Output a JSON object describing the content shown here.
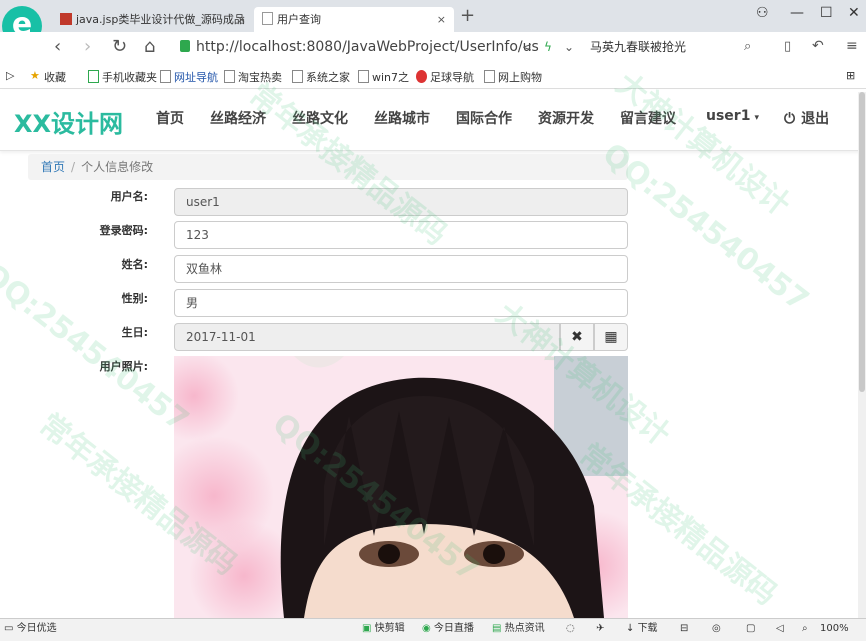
{
  "browser": {
    "tabs": [
      {
        "label": "java.jsp类毕业设计代做_源码成品"
      },
      {
        "label": "用户查询"
      }
    ],
    "url": "http://localhost:8080/JavaWebProject/UserInfo/us",
    "search_text": "马英九春联被抢光",
    "bookmarks": [
      "收藏",
      "手机收藏夹",
      "网址导航",
      "淘宝热卖",
      "系统之家",
      "win7之",
      "足球导航",
      "网上购物"
    ]
  },
  "site": {
    "brand": "XX设计网",
    "menu": [
      "首页",
      "丝路经济",
      "丝路文化",
      "丝路城市",
      "国际合作",
      "资源开发",
      "留言建议"
    ],
    "user": "user1",
    "logout": "退出"
  },
  "breadcrumb": {
    "home": "首页",
    "current": "个人信息修改"
  },
  "form": {
    "username_label": "用户名:",
    "username": "user1",
    "password_label": "登录密码:",
    "password": "123",
    "name_label": "姓名:",
    "name": "双鱼林",
    "gender_label": "性别:",
    "gender": "男",
    "birthday_label": "生日:",
    "birthday": "2017-11-01",
    "photo_label": "用户照片:"
  },
  "statusbar": {
    "left": "今日优选",
    "items": [
      "快剪辑",
      "今日直播",
      "热点资讯",
      "下载"
    ],
    "zoom": "100%"
  },
  "watermarks": [
    "常年承接精品源码",
    "QQ:254540457",
    "大神计算机设计",
    "QQ:254540457",
    "常年承接精品源码",
    "大神计算机设计",
    "QQ:254540457",
    "常年承接精品源码"
  ],
  "colors": {
    "brand": "#2bbb9f",
    "link": "#337ab7",
    "watermark": "#3cbe78"
  }
}
